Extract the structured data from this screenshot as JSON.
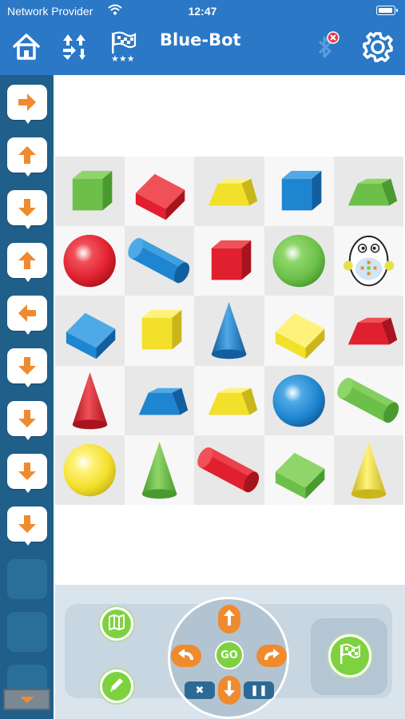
{
  "status_bar": {
    "carrier": "Network Provider",
    "time": "12:47"
  },
  "nav_bar": {
    "title": "Blue-Bot",
    "icons": [
      "home-icon",
      "shuffle-arrows-icon",
      "flag-stars-icon",
      "bluetooth-disconnected-icon",
      "gear-icon"
    ]
  },
  "program_commands": [
    "right",
    "up",
    "down",
    "up",
    "left",
    "down",
    "down",
    "down",
    "down"
  ],
  "empty_slots": 3,
  "grid": {
    "rows": 5,
    "cols": 5,
    "cells": [
      [
        "green-cube",
        "red-cuboid",
        "yellow-prism",
        "blue-cube",
        "green-prism"
      ],
      [
        "red-sphere",
        "blue-cylinder",
        "red-cube",
        "green-sphere",
        "robot"
      ],
      [
        "blue-cuboid",
        "yellow-cube",
        "blue-cone",
        "yellow-cuboid",
        "red-prism"
      ],
      [
        "red-cone",
        "blue-prism",
        "yellow-prism",
        "blue-sphere",
        "green-cylinder"
      ],
      [
        "yellow-sphere",
        "green-cone",
        "red-cylinder",
        "green-cuboid",
        "yellow-cone"
      ]
    ]
  },
  "controls": {
    "go_label": "GO",
    "clear_label": "✖",
    "pause_label": "❚❚",
    "left_buttons": [
      "map-icon",
      "pencil-icon"
    ],
    "right_button": "flag-icon"
  },
  "colors": {
    "header_blue": "#2a78c6",
    "sidebar_blue": "#1f5f8a",
    "command_orange": "#f08a2e",
    "button_green": "#7ed23f"
  }
}
